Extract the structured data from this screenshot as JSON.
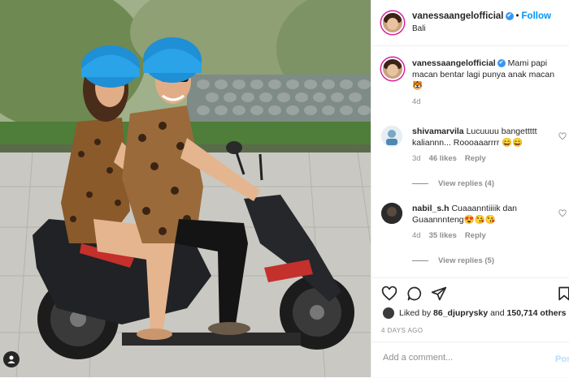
{
  "header": {
    "username": "vanessaangelofficial",
    "verified_mark": "✔",
    "separator": "•",
    "follow_label": "Follow",
    "location": "Bali"
  },
  "caption": {
    "username": "vanessaangelofficial",
    "verified_mark": "✔",
    "text": "Mami papi macan bentar lagi punya anak macan 🐯",
    "age": "4d"
  },
  "comments": [
    {
      "username": "shivamarvila",
      "text": "Lucuuuu bangettttt kaliannn... Roooaaarrrr 😄😄",
      "age": "3d",
      "likes": "46 likes",
      "reply_label": "Reply",
      "view_replies": "View replies (4)"
    },
    {
      "username": "nabil_s.h",
      "text": "Cuaaanntiiiik dan Guaannnteng😍😘😘",
      "age": "4d",
      "likes": "35 likes",
      "reply_label": "Reply",
      "view_replies": "View replies (5)"
    }
  ],
  "actions": {
    "icons": [
      "heart-icon",
      "comment-icon",
      "share-icon",
      "bookmark-icon"
    ]
  },
  "likes": {
    "prefix": "Liked by",
    "user": "86_djuprysky",
    "conj": "and",
    "others": "150,714 others"
  },
  "timestamp": "4 DAYS AGO",
  "add_comment": {
    "placeholder": "Add a comment...",
    "post_label": "Post"
  },
  "colors": {
    "accent": "#0095f6",
    "verified": "#3897f0",
    "muted": "#8e8e8e",
    "helmet": "#1f8fd6"
  }
}
